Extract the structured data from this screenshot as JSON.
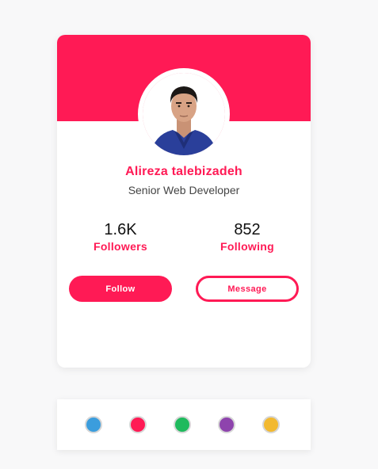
{
  "profile": {
    "name": "Alireza talebizadeh",
    "role": "Senior Web Developer",
    "stats": [
      {
        "value": "1.6K",
        "label": "Followers"
      },
      {
        "value": "852",
        "label": "Following"
      }
    ]
  },
  "actions": {
    "follow_label": "Follow",
    "message_label": "Message"
  },
  "theme": {
    "accent": "#ff1a55"
  },
  "swatches": [
    {
      "name": "blue",
      "color": "#3b9ddd"
    },
    {
      "name": "pink",
      "color": "#ff1a55"
    },
    {
      "name": "green",
      "color": "#1fba5d"
    },
    {
      "name": "purple",
      "color": "#8e44ad"
    },
    {
      "name": "yellow",
      "color": "#f2b930"
    }
  ]
}
